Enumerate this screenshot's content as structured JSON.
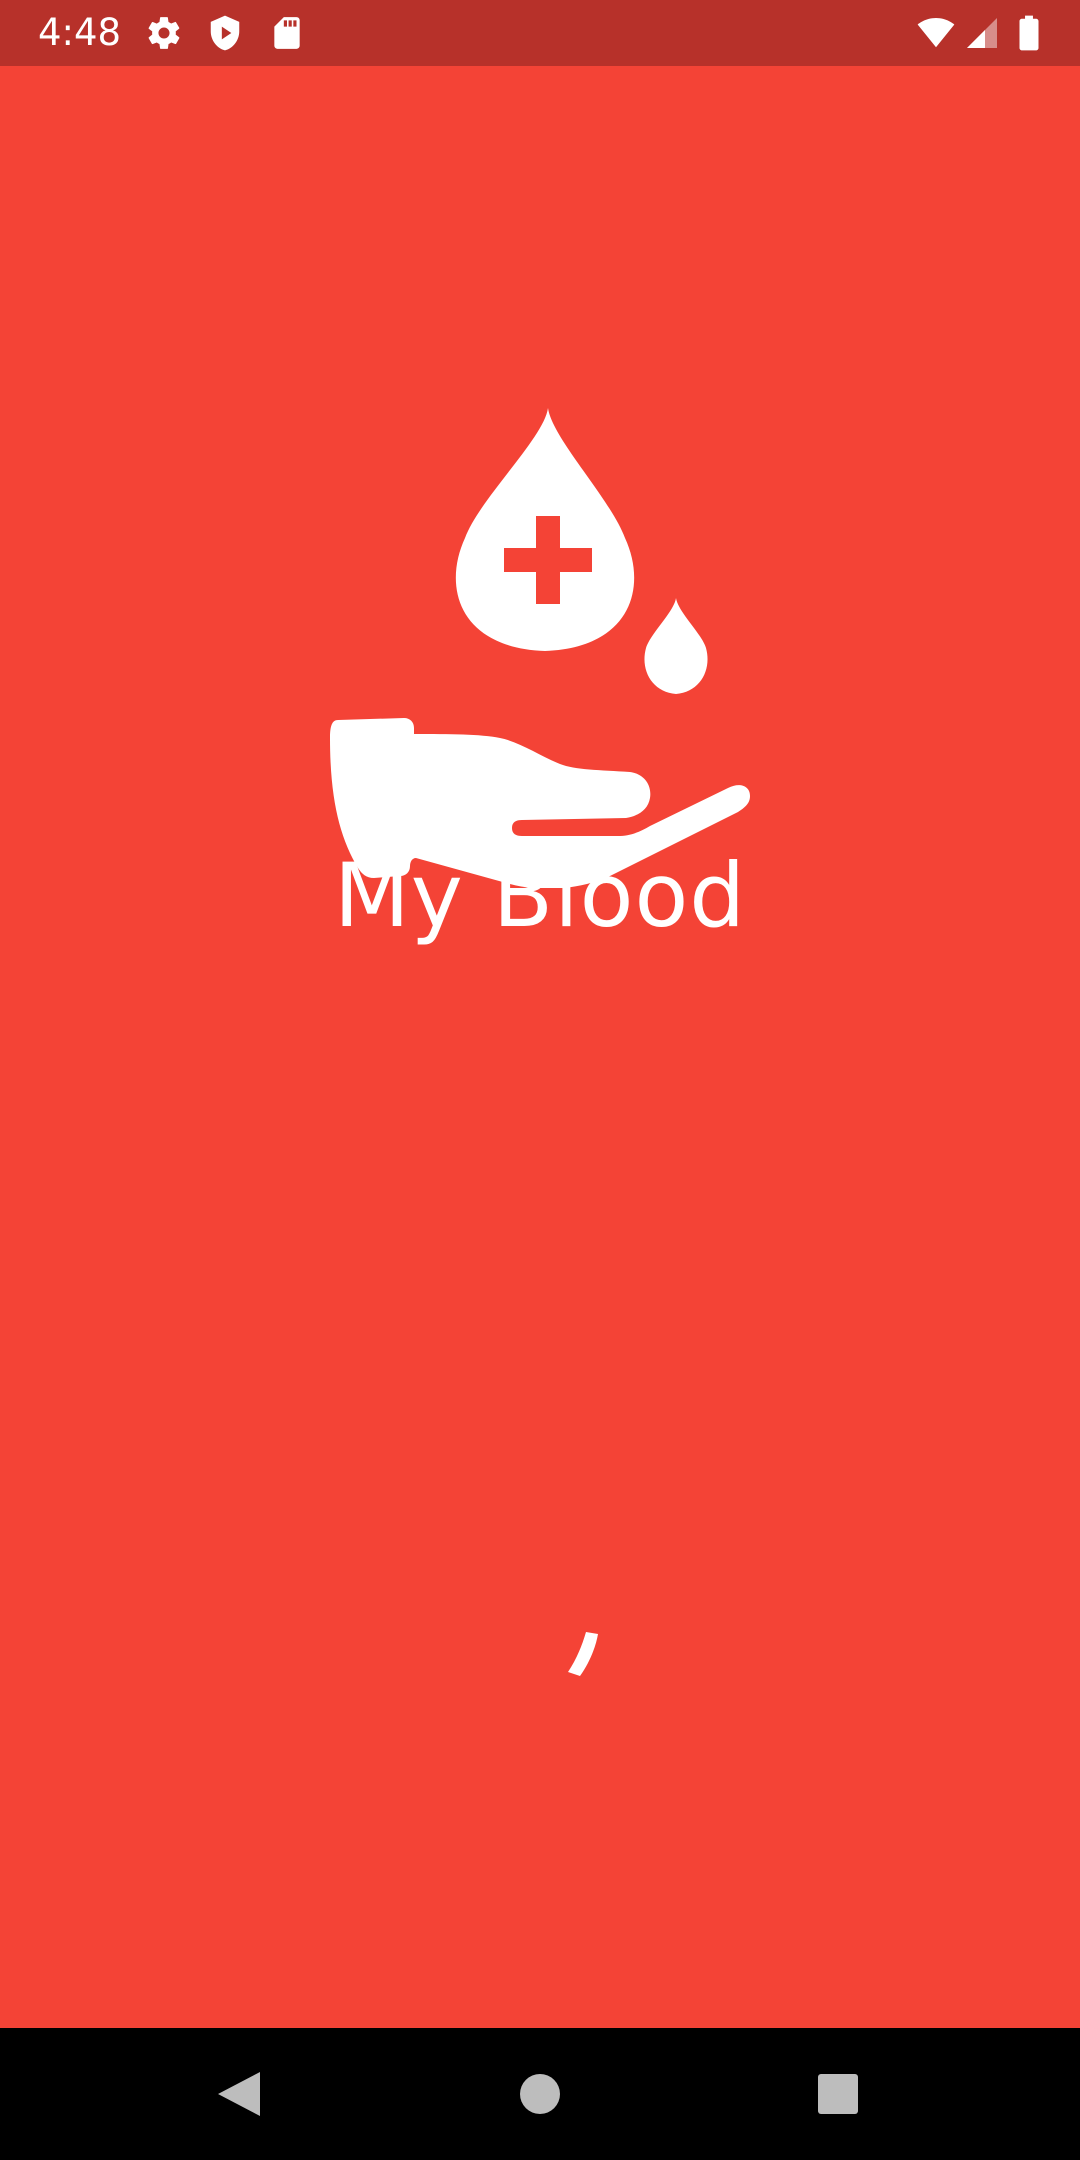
{
  "status_bar": {
    "time": "4:48",
    "left_icons": [
      "gear-icon",
      "shield-play-icon",
      "sd-card-icon"
    ],
    "right_icons": [
      "wifi-icon",
      "cell-signal-icon",
      "battery-icon"
    ],
    "background": "#B7312A"
  },
  "splash": {
    "title": "My Blood",
    "logo_icon": "blood-donation-hand-icon",
    "background": "#F44336",
    "foreground": "#FFFFFF"
  },
  "loading": {
    "indicator_icon": "spinner-icon"
  },
  "nav_bar": {
    "back_icon": "back-triangle-icon",
    "home_icon": "home-circle-icon",
    "recents_icon": "recents-square-icon",
    "background": "#000000"
  }
}
